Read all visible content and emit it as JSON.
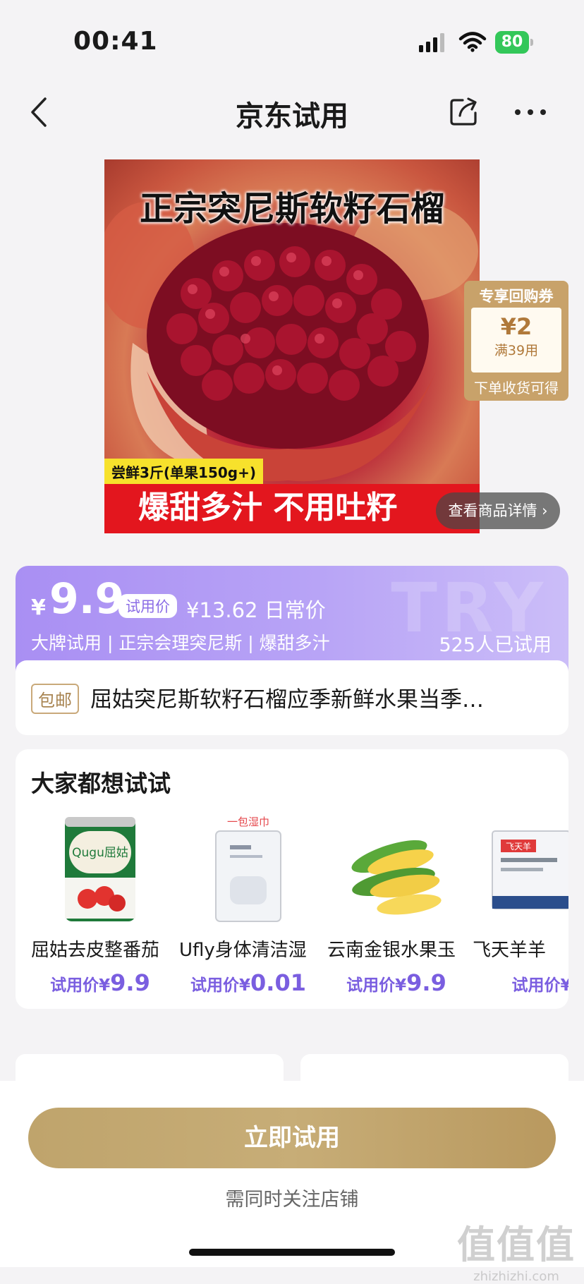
{
  "status_bar": {
    "time": "00:41",
    "battery": "80"
  },
  "nav": {
    "title": "京东试用"
  },
  "hero": {
    "title": "正宗突尼斯软籽石榴",
    "tag": "尝鲜3斤(单果150g+)",
    "banner": "爆甜多汁 不用吐籽",
    "detail_link": "查看商品详情 ›"
  },
  "coupon": {
    "header": "专享回购券",
    "amount": "¥2",
    "condition": "满39用",
    "footer": "下单收货可得"
  },
  "price": {
    "symbol": "¥",
    "value": "9.9",
    "badge": "试用价",
    "daily": "¥13.62 日常价",
    "tags": "大牌试用 | 正宗会理突尼斯 | 爆甜多汁",
    "tried_count": "525人已试用",
    "watermark": "TRY"
  },
  "product": {
    "shipping_badge": "包邮",
    "title": "屈姑突尼斯软籽石榴应季新鲜水果当季…"
  },
  "recommend": {
    "title": "大家都想试试",
    "items": [
      {
        "name": "屈姑去皮整番茄",
        "price_label": "试用价¥",
        "price": "9.9",
        "thumb_text": "Qugu屈姑"
      },
      {
        "name": "Ufly身体清洁湿",
        "price_label": "试用价¥",
        "price": "0.01",
        "thumb_text": "一包湿巾"
      },
      {
        "name": "云南金银水果玉",
        "price_label": "试用价¥",
        "price": "9.9",
        "thumb_text": ""
      },
      {
        "name": "飞天羊羊",
        "price_label": "试用价¥",
        "price": "",
        "thumb_text": "飞天羊"
      }
    ]
  },
  "bottom": {
    "cta": "立即试用",
    "note": "需同时关注店铺"
  },
  "watermark": {
    "big": "值值值",
    "small": "zhizhizhi.com"
  },
  "colors": {
    "accent_purple": "#a98ff3",
    "gold": "#c2a56d",
    "banner_red": "#e3161e"
  }
}
